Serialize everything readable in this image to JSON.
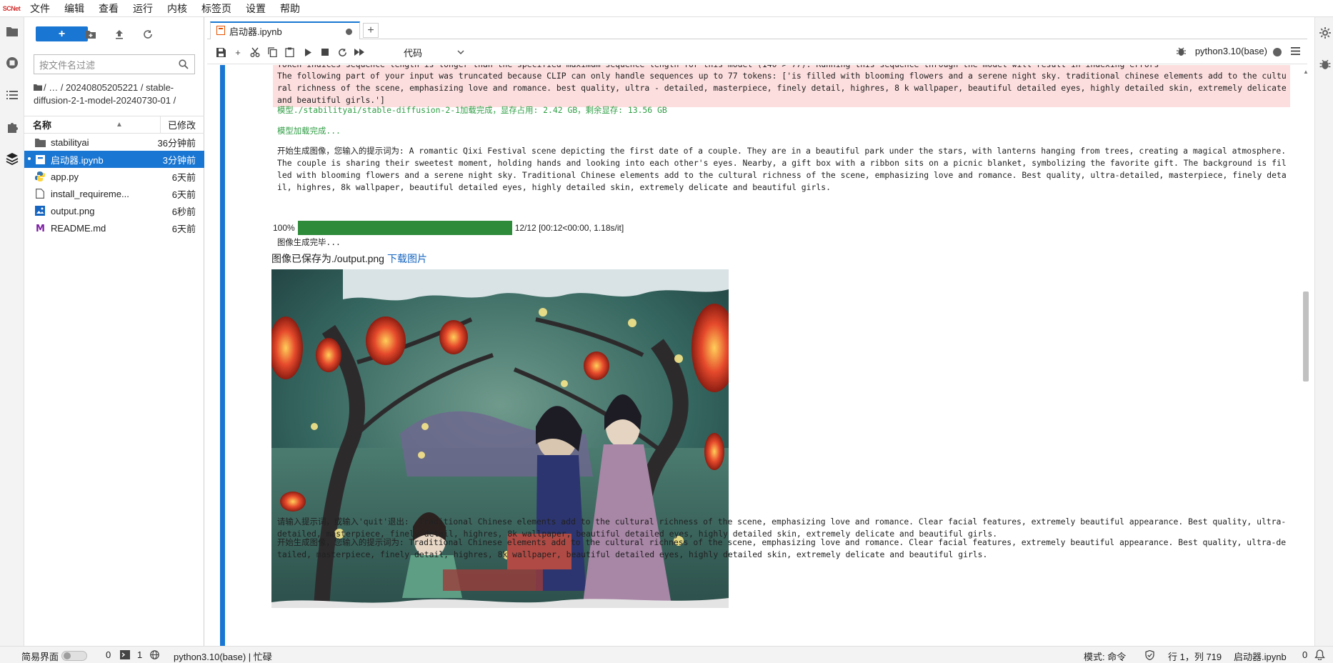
{
  "app": {
    "logo_text": "SCNet"
  },
  "menu": [
    "文件",
    "编辑",
    "查看",
    "运行",
    "内核",
    "标签页",
    "设置",
    "帮助"
  ],
  "filebrowser": {
    "new_label": "+",
    "filter_placeholder": "按文件名过滤",
    "breadcrumb": "/ … / 20240805205221 / stable-diffusion-2-1-model-20240730-01 /",
    "col_name": "名称",
    "col_modified": "已修改",
    "files": [
      {
        "name": "stabilityai",
        "modified": "36分钟前",
        "icon": "folder-icon",
        "selected": false
      },
      {
        "name": "启动器.ipynb",
        "modified": "3分钟前",
        "icon": "notebook-icon",
        "selected": true
      },
      {
        "name": "app.py",
        "modified": "6天前",
        "icon": "python-icon",
        "selected": false
      },
      {
        "name": "install_requireme...",
        "modified": "6天前",
        "icon": "file-icon",
        "selected": false
      },
      {
        "name": "output.png",
        "modified": "6秒前",
        "icon": "image-icon",
        "selected": false
      },
      {
        "name": "README.md",
        "modified": "6天前",
        "icon": "markdown-icon",
        "selected": false
      }
    ]
  },
  "notebook": {
    "tab_title": "启动器.ipynb",
    "cell_type": "代码",
    "kernel": "python3.10(base)"
  },
  "output": {
    "stderr_line0": "Token indices sequence length is longer than the specified maximum sequence length for this model (140 > 77). Running this sequence through the model will result in indexing errors",
    "stderr_text": "The following part of your input was truncated because CLIP can only handle sequences up to 77 tokens: ['is filled with blooming flowers and a serene night sky. traditional chinese elements add to the cultural richness of the scene, emphasizing love and romance. best quality, ultra - detailed, masterpiece, finely detail, highres, 8 k wallpaper, beautiful detailed eyes, highly detailed skin, extremely delicate and beautiful girls.']",
    "model_loaded": "模型./stabilityai/stable-diffusion-2-1加载完成，显存占用: 2.42 GB，剩余显存: 13.56 GB",
    "load_done": "模型加载完成...",
    "prompt_text": "开始生成图像，您输入的提示词为: A romantic Qixi Festival scene depicting the first date of a couple. They are in a beautiful park under the stars, with lanterns hanging from trees, creating a magical atmosphere. The couple is sharing their sweetest moment, holding hands and looking into each other's eyes. Nearby, a gift box with a ribbon sits on a picnic blanket, symbolizing the favorite gift. The background is filled with blooming flowers and a serene night sky. Traditional Chinese elements add to the cultural richness of the scene, emphasizing love and romance. Best quality, ultra-detailed, masterpiece, finely detail, highres, 8k wallpaper, beautiful detailed eyes, highly detailed skin, extremely delicate and beautiful girls.",
    "progress_percent_label": "100%",
    "progress_fraction": 1.0,
    "progress_info": "12/12 [00:12<00:00, 1.18s/it]",
    "gen_done": "图像生成完毕...",
    "saved_text": "图像已保存为./output.png",
    "download_link": "下载图片",
    "input_prompt": "请输入提示词，或输入'quit'退出:  Traditional Chinese elements add to the cultural richness of the scene, emphasizing love and romance. Clear facial features, extremely beautiful appearance. Best quality, ultra-detailed, masterpiece, finely detail, highres, 8k wallpaper, beautiful detailed eyes, highly detailed skin, extremely delicate and beautiful girls.",
    "prompt_text2": "开始生成图像，您输入的提示词为: Traditional Chinese elements add to the cultural richness of the scene, emphasizing love and romance. Clear facial features, extremely beautiful appearance. Best quality, ultra-detailed, masterpiece, finely detail, highres, 8k wallpaper, beautiful detailed eyes, highly detailed skin, extremely delicate and beautiful girls."
  },
  "statusbar": {
    "simple_mode": "简易界面",
    "count_a": "0",
    "count_b": "1",
    "kernel_status": "python3.10(base) | 忙碌",
    "mode": "模式: 命令",
    "position": "行 1，列 719",
    "file": "启动器.ipynb",
    "notifications": "0"
  },
  "colors": {
    "accent": "#1976d2",
    "stderr_bg": "#fddede",
    "success_green": "#2f9e44",
    "progress": "#2e8b3a"
  }
}
